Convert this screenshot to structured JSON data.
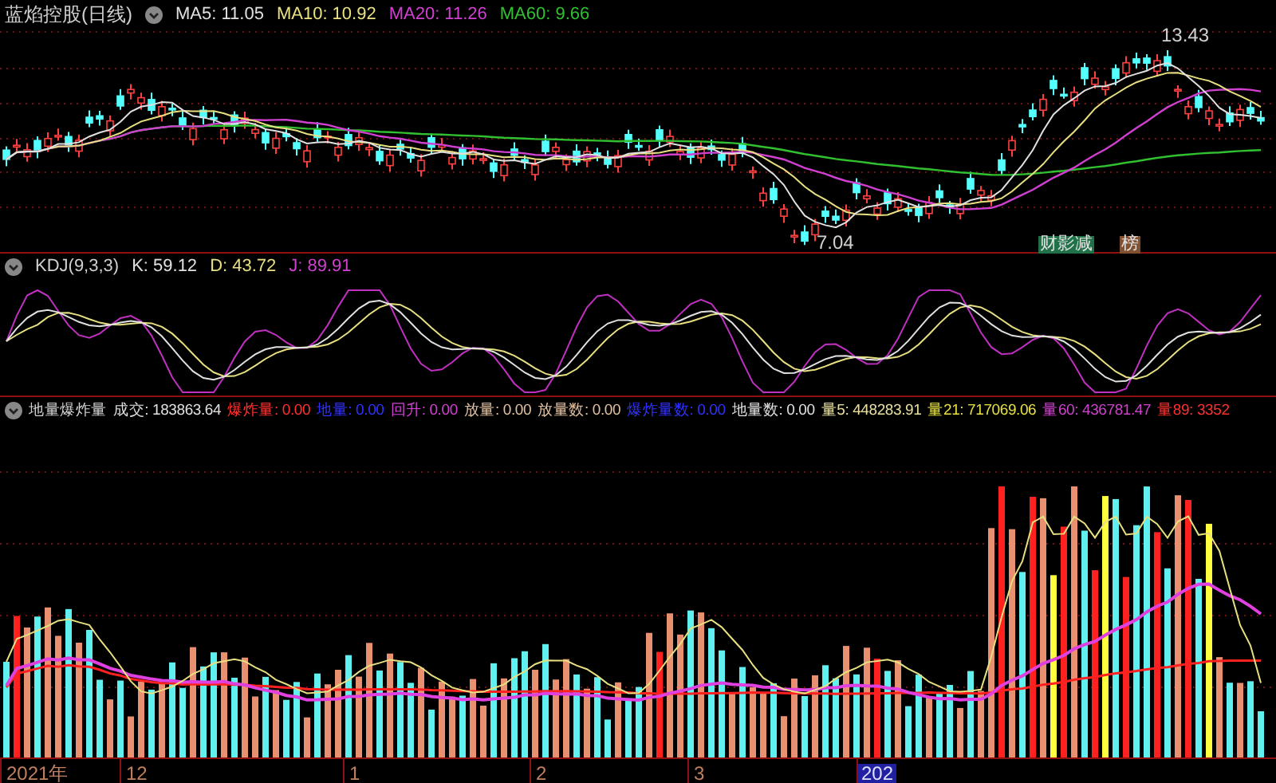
{
  "price_panel": {
    "title": "蓝焰控股(日线)",
    "indicators": [
      {
        "text": "MA5: 11.05",
        "color": "#e0e0e0"
      },
      {
        "text": "MA10: 10.92",
        "color": "#e8e080"
      },
      {
        "text": "MA20: 11.26",
        "color": "#d040d0"
      },
      {
        "text": "MA60: 9.66",
        "color": "#30c030"
      }
    ],
    "high_label": "13.43",
    "low_label": "7.04",
    "tags": [
      {
        "text": "财影减",
        "color": "#207048"
      },
      {
        "text": "榜",
        "color": "#805030"
      }
    ]
  },
  "kdj_panel": {
    "title": "KDJ(9,3,3)",
    "indicators": [
      {
        "text": "K: 59.12",
        "color": "#e0e0e0"
      },
      {
        "text": "D: 43.72",
        "color": "#e8e080"
      },
      {
        "text": "J: 89.91",
        "color": "#d040d0"
      }
    ]
  },
  "volume_panel": {
    "title": "地量爆炸量",
    "indicators": [
      {
        "text": "成交: 183863.64",
        "color": "#e0e0e0"
      },
      {
        "text": "爆炸量: 0.00",
        "color": "#ff3030"
      },
      {
        "text": "地量: 0.00",
        "color": "#3030ff"
      },
      {
        "text": "回升: 0.00",
        "color": "#d040d0"
      },
      {
        "text": "放量: 0.00",
        "color": "#e0c0a0"
      },
      {
        "text": "放量数: 0.00",
        "color": "#e0c0a0"
      },
      {
        "text": "爆炸量数: 0.00",
        "color": "#3030ff"
      },
      {
        "text": "地量数: 0.00",
        "color": "#e0e0e0"
      },
      {
        "text": "量5: 448283.91",
        "color": "#e8e0a0"
      },
      {
        "text": "量21: 717069.06",
        "color": "#e8e040"
      },
      {
        "text": "量60: 436781.47",
        "color": "#d040d0"
      },
      {
        "text": "量89: 3352",
        "color": "#ff3030"
      }
    ]
  },
  "time_axis": [
    {
      "label": "2021年",
      "selected": false
    },
    {
      "label": "12",
      "selected": false
    },
    {
      "label": "1",
      "selected": false
    },
    {
      "label": "2",
      "selected": false
    },
    {
      "label": "3",
      "selected": false
    },
    {
      "label": "202",
      "selected": true
    }
  ]
}
